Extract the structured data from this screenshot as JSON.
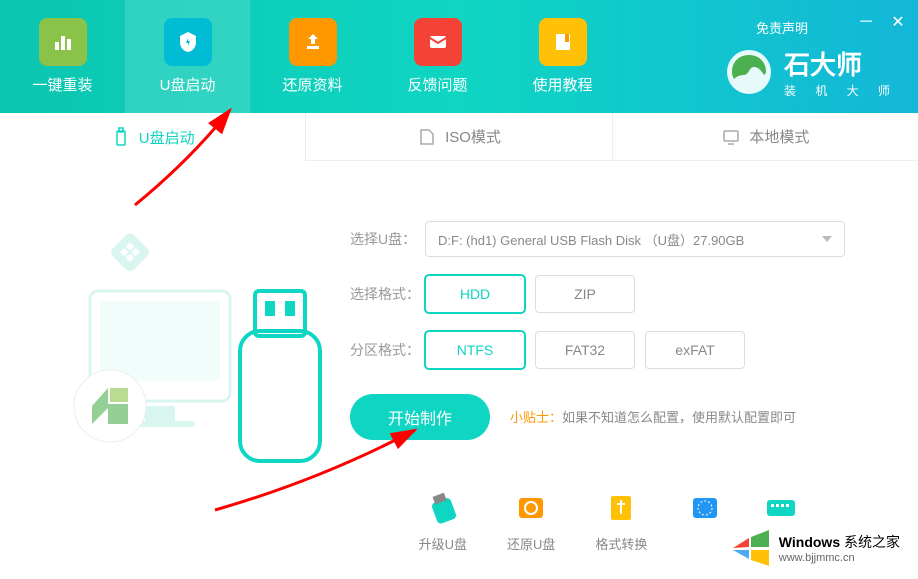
{
  "header": {
    "nav": [
      {
        "label": "一键重装",
        "icon": "reinstall"
      },
      {
        "label": "U盘启动",
        "icon": "usb-boot"
      },
      {
        "label": "还原资料",
        "icon": "restore"
      },
      {
        "label": "反馈问题",
        "icon": "feedback"
      },
      {
        "label": "使用教程",
        "icon": "tutorial"
      }
    ],
    "disclaimer": "免责声明",
    "logo_title": "石大师",
    "logo_subtitle": "装 机 大 师"
  },
  "mode_tabs": [
    {
      "label": "U盘启动",
      "icon": "usb"
    },
    {
      "label": "ISO模式",
      "icon": "iso"
    },
    {
      "label": "本地模式",
      "icon": "local"
    }
  ],
  "form": {
    "usb_label": "选择U盘：",
    "usb_value": "D:F: (hd1) General USB Flash Disk （U盘）27.90GB",
    "format_label": "选择格式：",
    "format_options": [
      "HDD",
      "ZIP"
    ],
    "partition_label": "分区格式：",
    "partition_options": [
      "NTFS",
      "FAT32",
      "exFAT"
    ],
    "start_button": "开始制作",
    "tip_label": "小贴士：",
    "tip_text": "如果不知道怎么配置，使用默认配置即可"
  },
  "tools": [
    {
      "label": "升级U盘"
    },
    {
      "label": "还原U盘"
    },
    {
      "label": "格式转换"
    },
    {
      "label": ""
    },
    {
      "label": ""
    }
  ],
  "watermark": {
    "title": "Windows",
    "subtitle": "系统之家",
    "url": "www.bjjmmc.cn"
  }
}
